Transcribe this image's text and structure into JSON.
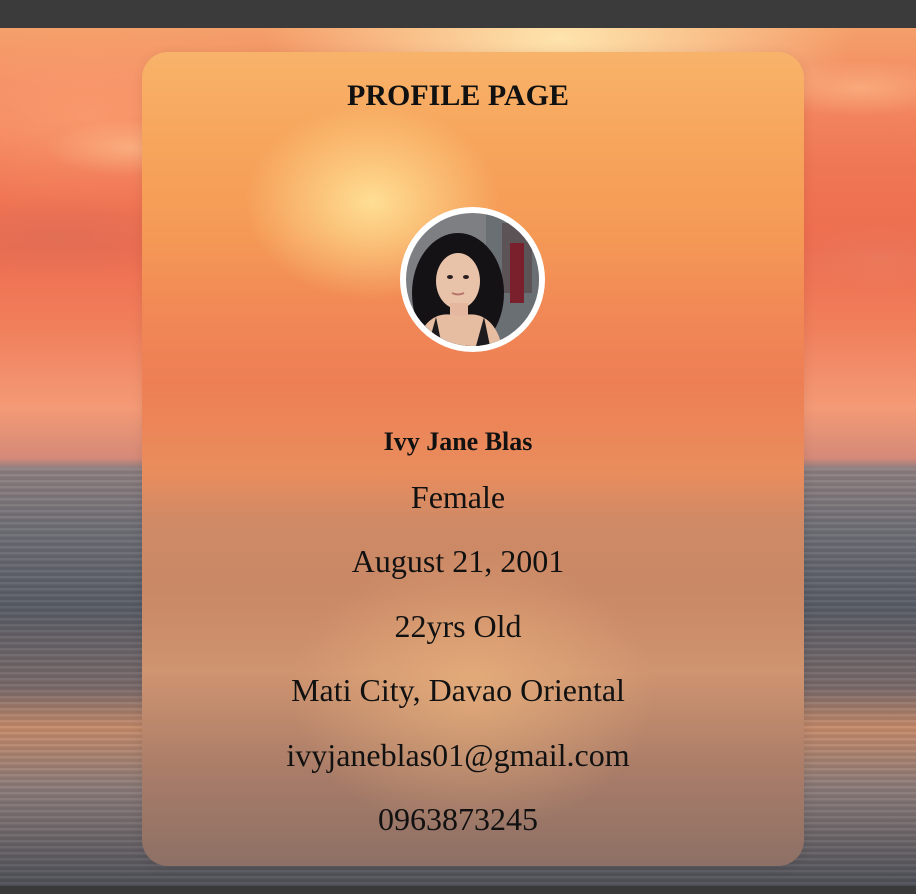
{
  "profile": {
    "title": "PROFILE PAGE",
    "name": "Ivy Jane Blas",
    "gender": "Female",
    "birthdate": "August 21, 2001",
    "age": "22yrs Old",
    "address": "Mati City, Davao Oriental",
    "email": "ivyjaneblas01@gmail.com",
    "phone": "0963873245"
  },
  "colors": {
    "text": "#111111",
    "avatar_border": "#ffffff"
  }
}
